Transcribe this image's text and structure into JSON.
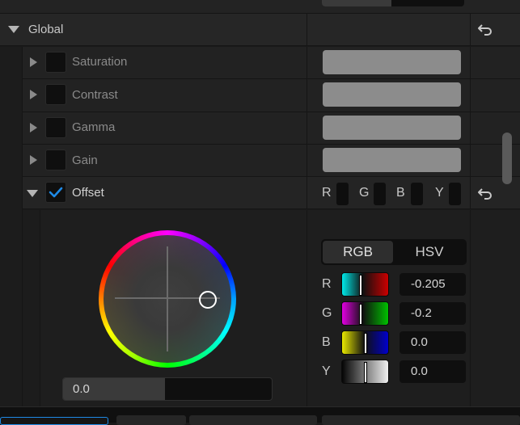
{
  "section": {
    "title": "Global",
    "reset_icon": "undo-arrow-icon"
  },
  "properties": [
    {
      "label": "Saturation",
      "checked": false
    },
    {
      "label": "Contrast",
      "checked": false
    },
    {
      "label": "Gamma",
      "checked": false
    },
    {
      "label": "Gain",
      "checked": false
    }
  ],
  "offset": {
    "label": "Offset",
    "checked": true,
    "channels": [
      "R",
      "G",
      "B",
      "Y"
    ],
    "reset_icon": "undo-arrow-icon"
  },
  "color_picker": {
    "wheel_value": "0.0",
    "modes": [
      "RGB",
      "HSV"
    ],
    "active_mode": "RGB",
    "rows": [
      {
        "label": "R",
        "value": "-0.205"
      },
      {
        "label": "G",
        "value": "-0.2"
      },
      {
        "label": "B",
        "value": "0.0"
      },
      {
        "label": "Y",
        "value": "0.0"
      }
    ]
  },
  "colors": {
    "accent_check": "#1e8ae6"
  }
}
